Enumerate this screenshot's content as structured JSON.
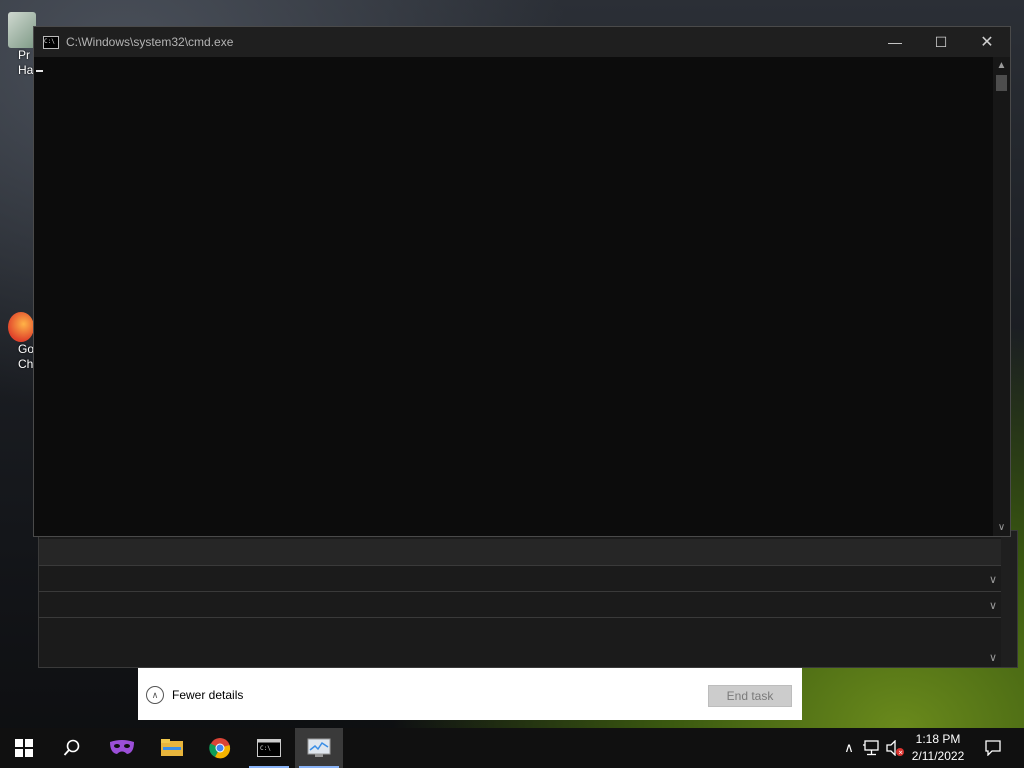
{
  "desktop": {
    "icons": [
      {
        "label_line1": "Pr",
        "label_line2": "Ha"
      },
      {
        "label_line1": "Go",
        "label_line2": "Ch"
      }
    ]
  },
  "cmd_window": {
    "title": "C:\\Windows\\system32\\cmd.exe",
    "icon_text": "C:\\",
    "minimize_glyph": "—",
    "maximize_glyph": "☐",
    "close_glyph": "✕",
    "content": ""
  },
  "task_manager": {
    "fewer_details_label": "Fewer details",
    "end_task_label": "End task"
  },
  "taskbar": {
    "apps": [
      "start-button",
      "search",
      "incognito-app",
      "file-explorer",
      "chrome",
      "cmd",
      "task-manager"
    ],
    "clock_time": "1:18 PM",
    "clock_date": "2/11/2022"
  },
  "colors": {
    "console_bg": "#0c0c0c",
    "titlebar_bg": "#1f1f1f",
    "taskbar_bg": "#101010",
    "accent": "#8ab4f8"
  }
}
